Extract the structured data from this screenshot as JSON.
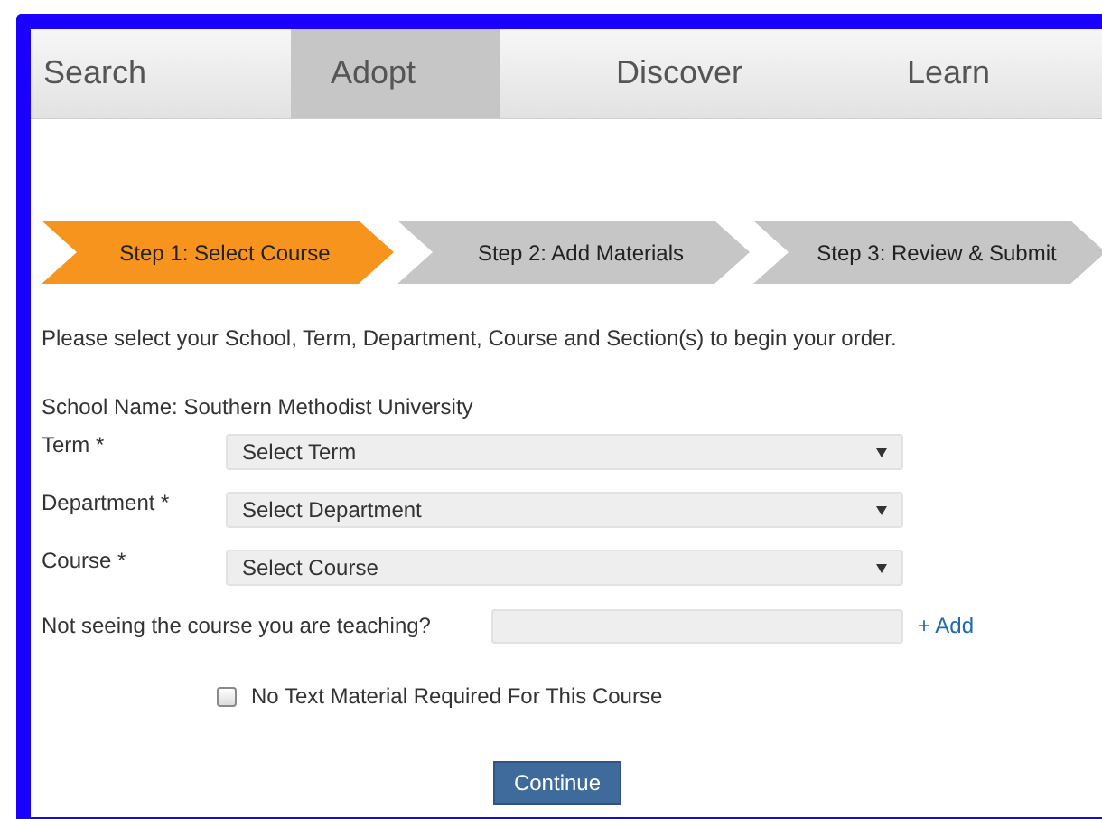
{
  "nav": [
    {
      "label": "Search",
      "selected": false
    },
    {
      "label": "Adopt",
      "selected": true
    },
    {
      "label": "Discover",
      "selected": false
    },
    {
      "label": "Learn",
      "selected": false
    }
  ],
  "steps": [
    {
      "label": "Step 1: Select Course",
      "selected": true
    },
    {
      "label": "Step 2: Add Materials",
      "selected": false
    },
    {
      "label": "Step 3: Review & Submit",
      "selected": false
    }
  ],
  "intro": "Please select your School, Term, Department, Course and Section(s) to begin your order.",
  "school": "School Name: Southern Methodist University",
  "selects": [
    {
      "label": "Term *",
      "value": "Select Term"
    },
    {
      "label": "Department *",
      "value": "Select Department"
    },
    {
      "label": "Course *",
      "value": "Select Course"
    }
  ],
  "missing_course": {
    "label": "Not seeing the course you are teaching?",
    "link": "+ Add"
  },
  "no_text_material": {
    "label": "No Text Material Required For This Course",
    "checked": false
  },
  "continue_button": "Continue"
}
